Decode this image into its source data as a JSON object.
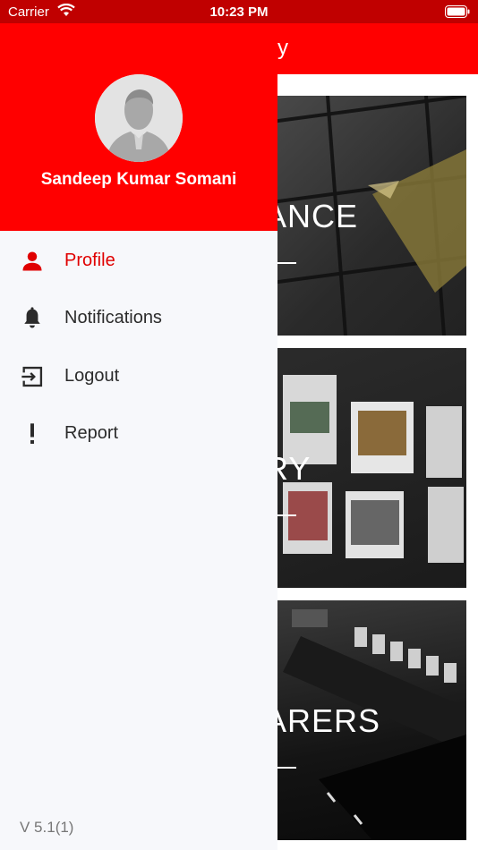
{
  "status_bar": {
    "carrier": "Carrier",
    "time": "10:23 PM"
  },
  "app": {
    "header_title_fragment": "y",
    "cards": [
      {
        "label": "ANCE"
      },
      {
        "label": "RY"
      },
      {
        "label": "ARERS"
      }
    ]
  },
  "drawer": {
    "user_name": "Sandeep Kumar Somani",
    "menu": [
      {
        "label": "Profile",
        "icon": "person-icon",
        "active": true
      },
      {
        "label": "Notifications",
        "icon": "bell-icon",
        "active": false
      },
      {
        "label": "Logout",
        "icon": "logout-icon",
        "active": false
      },
      {
        "label": "Report",
        "icon": "exclamation-icon",
        "active": false
      }
    ],
    "version": "V 5.1(1)"
  },
  "colors": {
    "accent": "#ff0000",
    "active_text": "#e00000",
    "status_bar": "#c00000",
    "drawer_bg": "#f7f8fb"
  }
}
